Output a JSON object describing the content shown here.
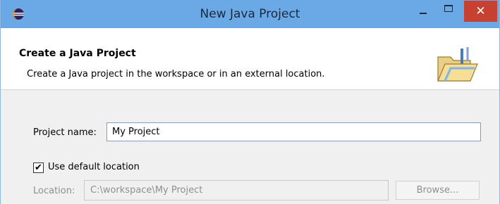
{
  "window": {
    "title": "New Java Project",
    "close_glyph": "✕"
  },
  "header": {
    "title": "Create a Java Project",
    "description": "Create a Java project in the workspace or in an external location."
  },
  "form": {
    "project_name_label": "Project name:",
    "project_name_value": "My Project",
    "use_default_label": "Use default location",
    "use_default_checked": true,
    "check_glyph": "✔",
    "location_label": "Location:",
    "location_value": "C:\\workspace\\My Project",
    "browse_label": "Browse..."
  },
  "colors": {
    "titlebar": "#6aa8e6",
    "close_button": "#c74133"
  }
}
